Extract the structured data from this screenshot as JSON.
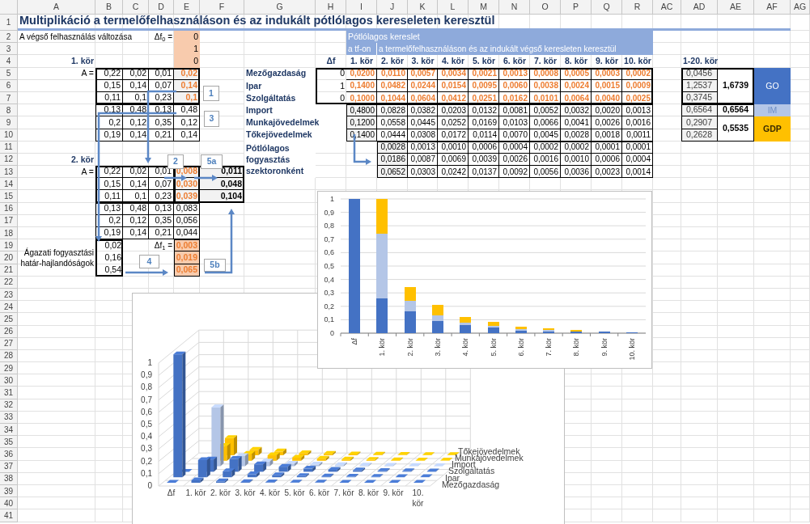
{
  "column_headers": [
    "A",
    "B",
    "C",
    "D",
    "E",
    "F",
    "G",
    "H",
    "I",
    "J",
    "K",
    "L",
    "M",
    "N",
    "O",
    "P",
    "Q",
    "R",
    "AC",
    "AD",
    "AE",
    "AF",
    "AG"
  ],
  "row_numbers": [
    "1",
    "2",
    "3",
    "4",
    "5",
    "6",
    "7",
    "8",
    "9",
    "10",
    "11",
    "12",
    "13",
    "14",
    "15",
    "16",
    "17",
    "18",
    "19",
    "20",
    "21",
    "22",
    "23",
    "24",
    "25",
    "26",
    "27",
    "28",
    "29",
    "30",
    "31",
    "32",
    "33",
    "34",
    "35",
    "36",
    "37",
    "38",
    "39",
    "40",
    "41"
  ],
  "title": "Multiplikáció a termelőfelhasználáson és az indukált pótlólagos kereseleten keresztül",
  "final_demand": {
    "label": "A végső felhasználás változása",
    "symbol": "Δf$_{0}$ =",
    "values": [
      "0",
      "1",
      "0"
    ]
  },
  "round_1": {
    "label": "1. kör",
    "matrix_label": "A =",
    "matrix": [
      [
        "0,22",
        "0,02",
        "0,01",
        "0,02"
      ],
      [
        "0,15",
        "0,14",
        "0,07",
        "0,14"
      ],
      [
        "0,11",
        "0,1",
        "0,23",
        "0,1"
      ],
      [
        "0,13",
        "0,48",
        "0,13",
        "0,48"
      ],
      [
        "0,2",
        "0,12",
        "0,35",
        "0,12"
      ],
      [
        "0,19",
        "0,14",
        "0,21",
        "0,14"
      ]
    ]
  },
  "round_2": {
    "label": "2. kör",
    "matrix_label": "A =",
    "matrix": [
      [
        "0,22",
        "0,02",
        "0,01",
        "0,008"
      ],
      [
        "0,15",
        "0,14",
        "0,07",
        "0,030"
      ],
      [
        "0,11",
        "0,1",
        "0,23",
        "0,039"
      ],
      [
        "0,13",
        "0,48",
        "0,13",
        "0,083"
      ],
      [
        "0,2",
        "0,12",
        "0,35",
        "0,056"
      ],
      [
        "0,19",
        "0,14",
        "0,21",
        "0,044"
      ]
    ],
    "consumption": [
      "0,011",
      "0,048",
      "0,104"
    ],
    "propensity_label": "Ágazati fogyasztási határ-hajlandóságok",
    "propensities": [
      "0,02",
      "0,16",
      "0,54"
    ],
    "delta_label": "Δf$_{1}$ =",
    "delta": [
      "0,003",
      "0,019",
      "0,065"
    ]
  },
  "callouts": [
    "1",
    "3",
    "2",
    "5a",
    "4",
    "5b"
  ],
  "demand_table": {
    "band": "Pótlólagos kereslet",
    "sub_headers": [
      "a tf-on",
      "a termelőfelhasználáson és az indukált végső keresleten keresztül"
    ],
    "columns": [
      "Δf",
      "1. kör",
      "2. kör",
      "3. kör",
      "4. kör",
      "5. kör",
      "6. kör",
      "7. kör",
      "8. kör",
      "9. kör",
      "10. kör"
    ],
    "rows": [
      {
        "label": "Mezőgazdaság",
        "kind": "sector",
        "delta": "0",
        "values": [
          "0,0200",
          "0,0110",
          "0,0057",
          "0,0034",
          "0,0021",
          "0,0013",
          "0,0008",
          "0,0005",
          "0,0003",
          "0,0002"
        ]
      },
      {
        "label": "Ipar",
        "kind": "sector",
        "delta": "1",
        "values": [
          "0,1400",
          "0,0482",
          "0,0244",
          "0,0154",
          "0,0095",
          "0,0060",
          "0,0038",
          "0,0024",
          "0,0015",
          "0,0009"
        ]
      },
      {
        "label": "Szolgáltatás",
        "kind": "sector",
        "delta": "0",
        "values": [
          "0,1000",
          "0,1044",
          "0,0604",
          "0,0412",
          "0,0251",
          "0,0162",
          "0,0101",
          "0,0064",
          "0,0040",
          "0,0025"
        ]
      },
      {
        "label": "Import",
        "kind": "factor",
        "values": [
          "0,4800",
          "0,0828",
          "0,0382",
          "0,0203",
          "0,0132",
          "0,0081",
          "0,0052",
          "0,0032",
          "0,0020",
          "0,0013"
        ]
      },
      {
        "label": "Munkajövedelmek",
        "kind": "factor",
        "values": [
          "0,1200",
          "0,0558",
          "0,0445",
          "0,0252",
          "0,0169",
          "0,0103",
          "0,0066",
          "0,0041",
          "0,0026",
          "0,0016"
        ]
      },
      {
        "label": "Tőkejövedelmek",
        "kind": "factor",
        "values": [
          "0,1400",
          "0,0444",
          "0,0308",
          "0,0172",
          "0,0114",
          "0,0070",
          "0,0045",
          "0,0028",
          "0,0018",
          "0,0011"
        ]
      }
    ],
    "consumption_label": "Pótlólagos fogyasztás szektoronként",
    "consumption_rows": [
      [
        "0,0028",
        "0,0013",
        "0,0010",
        "0,0006",
        "0,0004",
        "0,0002",
        "0,0002",
        "0,0001",
        "0,0001"
      ],
      [
        "0,0186",
        "0,0087",
        "0,0069",
        "0,0039",
        "0,0026",
        "0,0016",
        "0,0010",
        "0,0006",
        "0,0004"
      ],
      [
        "0,0652",
        "0,0303",
        "0,0242",
        "0,0137",
        "0,0092",
        "0,0056",
        "0,0036",
        "0,0023",
        "0,0014"
      ]
    ]
  },
  "totals": {
    "label": "1-20. kör",
    "sector_values": [
      "0,0456",
      "1,2537",
      "0,3745",
      "0,6564",
      "0,2907",
      "0,2628"
    ],
    "aggregates": [
      {
        "value": "1,6739",
        "name": "GO",
        "kind": "go"
      },
      {
        "value": "0,6564",
        "name": "IM",
        "kind": "im"
      },
      {
        "value": "0,5535",
        "name": "GDP",
        "kind": "gdp"
      }
    ]
  },
  "charts": [
    {
      "chart_data": {
        "type": "bar",
        "stacked": true,
        "grid": true,
        "categories": [
          "Δf",
          "1. kör",
          "2. kör",
          "3. kör",
          "4. kör",
          "5. kör",
          "6. kör",
          "7. kör",
          "8. kör",
          "9. kör",
          "10. kör"
        ],
        "series": [
          {
            "color": "#4472c4",
            "values": [
              1,
              0.26,
              0.16,
              0.09,
              0.06,
              0.04,
              0.02,
              0.01,
              0.01,
              0.01,
              0.004
            ]
          },
          {
            "color": "#b4c6e7",
            "values": [
              0,
              0.48,
              0.08,
              0.04,
              0.02,
              0.01,
              0.01,
              0.01,
              0,
              0,
              0
            ]
          },
          {
            "color": "#ffc000",
            "values": [
              0,
              0.26,
              0.1,
              0.08,
              0.04,
              0.03,
              0.02,
              0.01,
              0.01,
              0,
              0
            ]
          }
        ],
        "ylim": [
          0,
          1
        ],
        "yticks": [
          {
            "value": 0,
            "label": "0"
          },
          {
            "value": 0.1,
            "label": "0,1"
          },
          {
            "value": 0.2,
            "label": "0,2"
          },
          {
            "value": 0.3,
            "label": "0,3"
          },
          {
            "value": 0.4,
            "label": "0,4"
          },
          {
            "value": 0.5,
            "label": "0,5"
          },
          {
            "value": 0.6,
            "label": "0,6"
          },
          {
            "value": 0.7,
            "label": "0,7"
          },
          {
            "value": 0.8,
            "label": "0,8"
          },
          {
            "value": 0.9,
            "label": "0,9"
          },
          {
            "value": 1,
            "label": "1"
          }
        ]
      }
    },
    {
      "chart_3d": {
        "y_labels": [
          "1",
          "0,9",
          "0,8",
          "0,7",
          "0,6",
          "0,5",
          "0,4",
          "0,3",
          "0,2",
          "0,1",
          "0"
        ],
        "categories": [
          "Δf",
          "1. kör",
          "2. kör",
          "3. kör",
          "4. kör",
          "5. kör",
          "6. kör",
          "7. kör",
          "8. kör",
          "9. kör",
          "10. kör"
        ],
        "series_labels": [
          "Tőkejövedelmek",
          "Munkajövedelmek",
          "Import",
          "Szolgáltatás",
          "Ipar",
          "Mezőgazdaság"
        ]
      }
    }
  ]
}
